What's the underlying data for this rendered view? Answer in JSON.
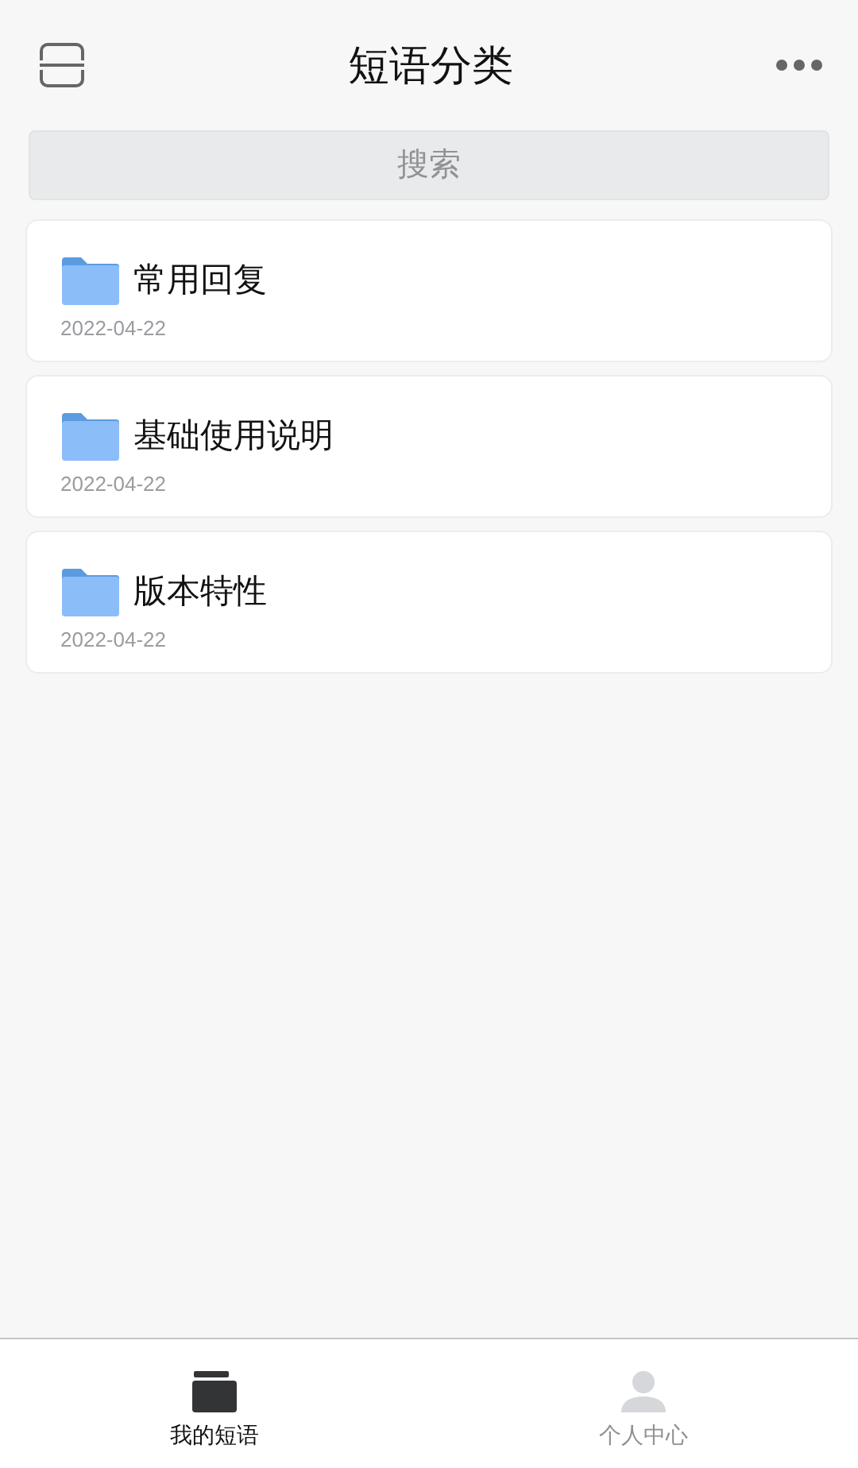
{
  "header": {
    "title": "短语分类"
  },
  "search": {
    "placeholder": "搜索"
  },
  "categories": [
    {
      "name": "常用回复",
      "date": "2022-04-22"
    },
    {
      "name": "基础使用说明",
      "date": "2022-04-22"
    },
    {
      "name": "版本特性",
      "date": "2022-04-22"
    }
  ],
  "tabs": [
    {
      "label": "我的短语",
      "kind": "folder",
      "selected": true
    },
    {
      "label": "个人中心",
      "kind": "person",
      "selected": false
    }
  ]
}
